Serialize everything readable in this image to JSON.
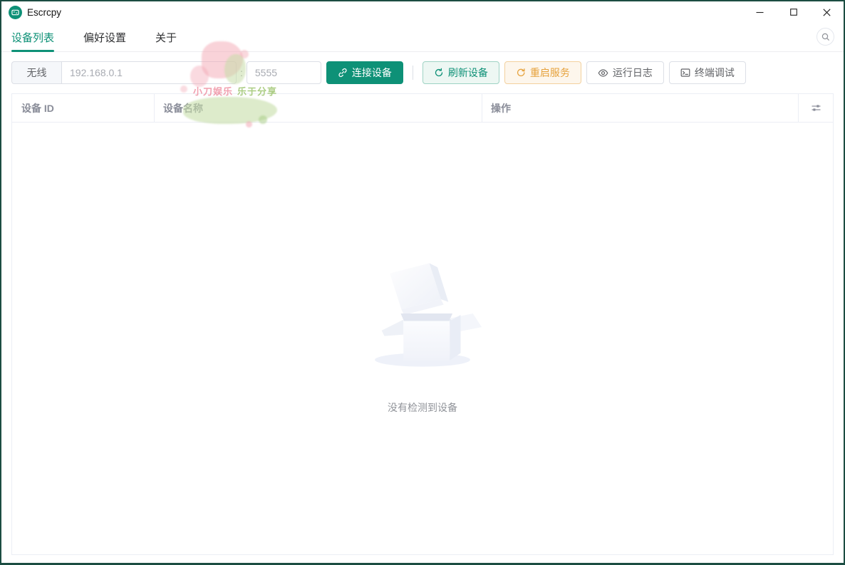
{
  "window": {
    "title": "Escrcpy"
  },
  "tabs": [
    {
      "label": "设备列表",
      "active": true
    },
    {
      "label": "偏好设置",
      "active": false
    },
    {
      "label": "关于",
      "active": false
    }
  ],
  "toolbar": {
    "wireless_label": "无线",
    "ip_placeholder": "192.168.0.1",
    "ip_value": "",
    "separator": ":",
    "port_placeholder": "5555",
    "port_value": "",
    "connect_label": "连接设备",
    "refresh_label": "刷新设备",
    "restart_label": "重启服务",
    "logs_label": "运行日志",
    "terminal_label": "终端调试"
  },
  "table": {
    "columns": [
      "设备 ID",
      "设备名称",
      "操作"
    ],
    "rows": [],
    "empty_text": "没有检测到设备"
  },
  "watermark": {
    "text_pink": "小刀娱乐",
    "text_green": "乐于分享"
  },
  "icons": {
    "app": "screen-mirror-icon",
    "connect": "link-icon",
    "refresh": "refresh-icon",
    "restart": "restart-icon",
    "logs": "eye-icon",
    "terminal": "terminal-icon",
    "header_settings": "column-settings-icon",
    "search": "search-icon"
  },
  "colors": {
    "primary": "#0e9177",
    "warning": "#e6a23c",
    "window_border": "#1b4d42",
    "border": "#dcdfe6",
    "table_border": "#ebeef5",
    "muted_text": "#909399"
  }
}
